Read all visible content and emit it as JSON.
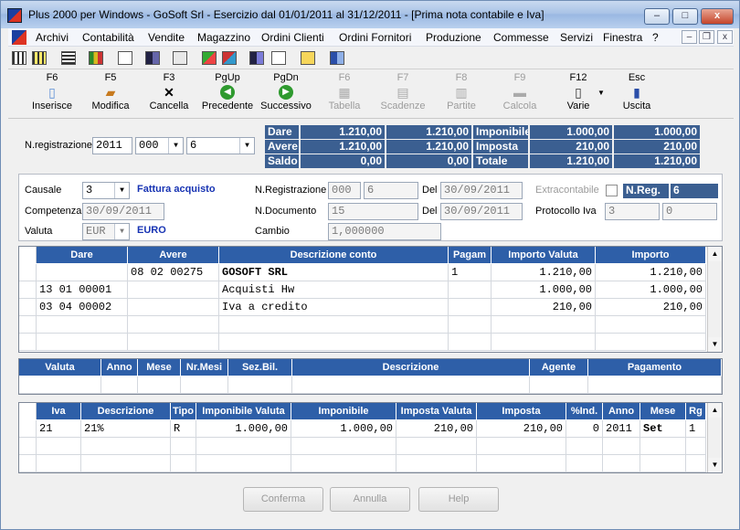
{
  "window": {
    "title": "Plus 2000 per Windows - GoSoft Srl - Esercizio dal 01/01/2011 al 31/12/2011 - [Prima nota contabile e Iva]",
    "minimize": "–",
    "maximize": "□",
    "close": "x"
  },
  "menu": {
    "items": [
      "Archivi",
      "Contabilità",
      "Vendite",
      "Magazzino",
      "Ordini Clienti",
      "Ordini Fornitori",
      "Produzione",
      "Commesse",
      "Servizi",
      "Finestra",
      "?"
    ],
    "mdi_min": "–",
    "mdi_restore": "❐",
    "mdi_close": "x"
  },
  "fbuttons": [
    {
      "key": "F6",
      "label": "Inserisce",
      "icon": "document-icon",
      "glyph": "📄",
      "disabled": false
    },
    {
      "key": "F5",
      "label": "Modifica",
      "icon": "edit-icon",
      "glyph": "✎",
      "disabled": false
    },
    {
      "key": "F3",
      "label": "Cancella",
      "icon": "delete-icon",
      "glyph": "✕",
      "disabled": false
    },
    {
      "key": "PgUp",
      "label": "Precedente",
      "icon": "arrow-left-icon",
      "glyph": "◀",
      "disabled": false
    },
    {
      "key": "PgDn",
      "label": "Successivo",
      "icon": "arrow-right-icon",
      "glyph": "▶",
      "disabled": false
    },
    {
      "key": "F6",
      "label": "Tabella",
      "icon": "table-icon",
      "glyph": "▦",
      "disabled": true
    },
    {
      "key": "F7",
      "label": "Scadenze",
      "icon": "calendar-icon",
      "glyph": "▤",
      "disabled": true
    },
    {
      "key": "F8",
      "label": "Partite",
      "icon": "ledger-icon",
      "glyph": "▥",
      "disabled": true
    },
    {
      "key": "F9",
      "label": "Calcola",
      "icon": "calculator-icon",
      "glyph": "▬",
      "disabled": true
    },
    {
      "key": "F12",
      "label": "Varie",
      "icon": "misc-icon",
      "glyph": "▯",
      "disabled": false
    },
    {
      "key": "Esc",
      "label": "Uscita",
      "icon": "exit-icon",
      "glyph": "⇥",
      "disabled": false
    }
  ],
  "header": {
    "nreg_label": "N.registrazione",
    "year": "2011",
    "series": "000",
    "number": "6"
  },
  "summary": {
    "rows": [
      {
        "label": "Dare",
        "v1": "1.210,00",
        "v2": "1.210,00",
        "label2": "Imponibile",
        "v3": "1.000,00",
        "v4": "1.000,00"
      },
      {
        "label": "Avere",
        "v1": "1.210,00",
        "v2": "1.210,00",
        "label2": "Imposta",
        "v3": "210,00",
        "v4": "210,00"
      },
      {
        "label": "Saldo",
        "v1": "0,00",
        "v2": "0,00",
        "label2": "Totale",
        "v3": "1.210,00",
        "v4": "1.210,00"
      }
    ]
  },
  "form": {
    "causale_label": "Causale",
    "causale_value": "3",
    "causale_desc": "Fattura acquisto",
    "competenza_label": "Competenza",
    "competenza_value": "30/09/2011",
    "valuta_label": "Valuta",
    "valuta_value": "EUR",
    "valuta_desc": "EURO",
    "nreg_label": "N.Registrazione",
    "nreg_series": "000",
    "nreg_number": "6",
    "del_label": "Del",
    "del_value": "30/09/2011",
    "ndoc_label": "N.Documento",
    "ndoc_value": "15",
    "del2_label": "Del",
    "del2_value": "30/09/2011",
    "cambio_label": "Cambio",
    "cambio_value": "1,000000",
    "extracontabile_label": "Extracontabile",
    "nreg_badge_label": "N.Reg.",
    "nreg_badge_value": "6",
    "protocollo_label": "Protocollo Iva",
    "protocollo_value": "3",
    "protocollo_suffix": "0"
  },
  "grid1": {
    "headers": [
      "Dare",
      "Avere",
      "Descrizione conto",
      "Pagam",
      "Importo Valuta",
      "Importo"
    ],
    "rows": [
      [
        "",
        "08 02 00275",
        "GOSOFT SRL",
        "1",
        "1.210,00",
        "1.210,00"
      ],
      [
        "13 01 00001",
        "",
        "Acquisti Hw",
        "",
        "1.000,00",
        "1.000,00"
      ],
      [
        "03 04 00002",
        "",
        "Iva a credito",
        "",
        "210,00",
        "210,00"
      ],
      [
        "",
        "",
        "",
        "",
        "",
        ""
      ],
      [
        "",
        "",
        "",
        "",
        "",
        ""
      ]
    ]
  },
  "grid2": {
    "headers": [
      "Valuta",
      "Anno",
      "Mese",
      "Nr.Mesi",
      "Sez.Bil.",
      "Descrizione",
      "Agente",
      "Pagamento"
    ]
  },
  "grid3": {
    "headers": [
      "Iva",
      "Descrizione",
      "Tipo",
      "Imponibile Valuta",
      "Imponibile",
      "Imposta Valuta",
      "Imposta",
      "%Ind.",
      "Anno",
      "Mese",
      "Rg"
    ],
    "rows": [
      [
        "21",
        "21%",
        "R",
        "1.000,00",
        "1.000,00",
        "210,00",
        "210,00",
        "0",
        "2011",
        "Set",
        "1"
      ],
      [
        "",
        "",
        "",
        "",
        "",
        "",
        "",
        "",
        "",
        "",
        ""
      ],
      [
        "",
        "",
        "",
        "",
        "",
        "",
        "",
        "",
        "",
        "",
        ""
      ]
    ]
  },
  "buttons": {
    "confirm": "Conferma",
    "cancel": "Annulla",
    "help": "Help"
  },
  "colors": {
    "grid_header": "#2e5fa8",
    "summary_bg": "#3b5f91",
    "link_blue": "#1733b3"
  }
}
